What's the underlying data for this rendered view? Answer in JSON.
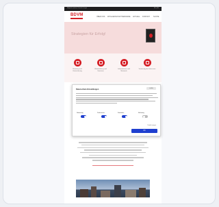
{
  "topbar": {
    "left": "Mitglied werden | Kontakt | Login",
    "right": "DE | EN"
  },
  "header": {
    "logo": "BDVM",
    "nav": [
      "ÜBER UNS",
      "MITGLIEDSCHAFT",
      "SEMINARE",
      "AKTUELL",
      "KONTAKT",
      "SUCHE"
    ]
  },
  "hero": {
    "title": "Strategien für Erfolg!"
  },
  "services": [
    {
      "label": "Beratung und Unterstützung"
    },
    {
      "label": "Weiterbildung und Seminare"
    },
    {
      "label": "Informationen und Netzwerk"
    },
    {
      "label": "Vertretung der Interessen"
    }
  ],
  "cookie_modal": {
    "title": "Datenschutz-Einstellungen",
    "brand": "cookie",
    "toggles": [
      {
        "label": "Notwendig",
        "on": true
      },
      {
        "label": "Präferenzen",
        "on": true
      },
      {
        "label": "Statistiken",
        "on": true
      },
      {
        "label": "Marketing",
        "on": false
      }
    ],
    "details_link": "Details zeigen",
    "accept_label": "OK"
  },
  "colors": {
    "brand": "#d51f26",
    "accept": "#1f3fcf"
  }
}
